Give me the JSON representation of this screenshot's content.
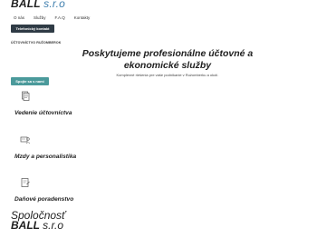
{
  "header": {
    "logo_main": "BALL",
    "logo_suffix": "s.r.o"
  },
  "nav": {
    "items": [
      "O nás",
      "Služby",
      "F.A.Q",
      "Kontakty"
    ]
  },
  "contact_button": "Telefonický kontakt",
  "subtitle_label": "ÚČTOVNÍCTVO RUŽOMBEROK",
  "hero": {
    "title": "Poskytujeme profesionálne účtovné a ekonomické služby",
    "subtitle": "Komplexné riešenia pre vaše podnikanie v Ružomberku a okolí."
  },
  "cta_button": "Spojte sa s nami",
  "services": [
    {
      "label": "Vedenie účtovníctva",
      "icon": "document-icon"
    },
    {
      "label": "Mzdy a personalistika",
      "icon": "payroll-icon"
    },
    {
      "label": "Daňové poradenstvo",
      "icon": "tax-icon"
    }
  ],
  "footer": {
    "line1": "Spoločnosť",
    "line2_main": "BALL",
    "line2_suffix": "s.r.o"
  },
  "colors": {
    "accent_blue": "#3f7fae",
    "dark_button": "#2f3b45",
    "teal_button": "#4b9a9b"
  }
}
